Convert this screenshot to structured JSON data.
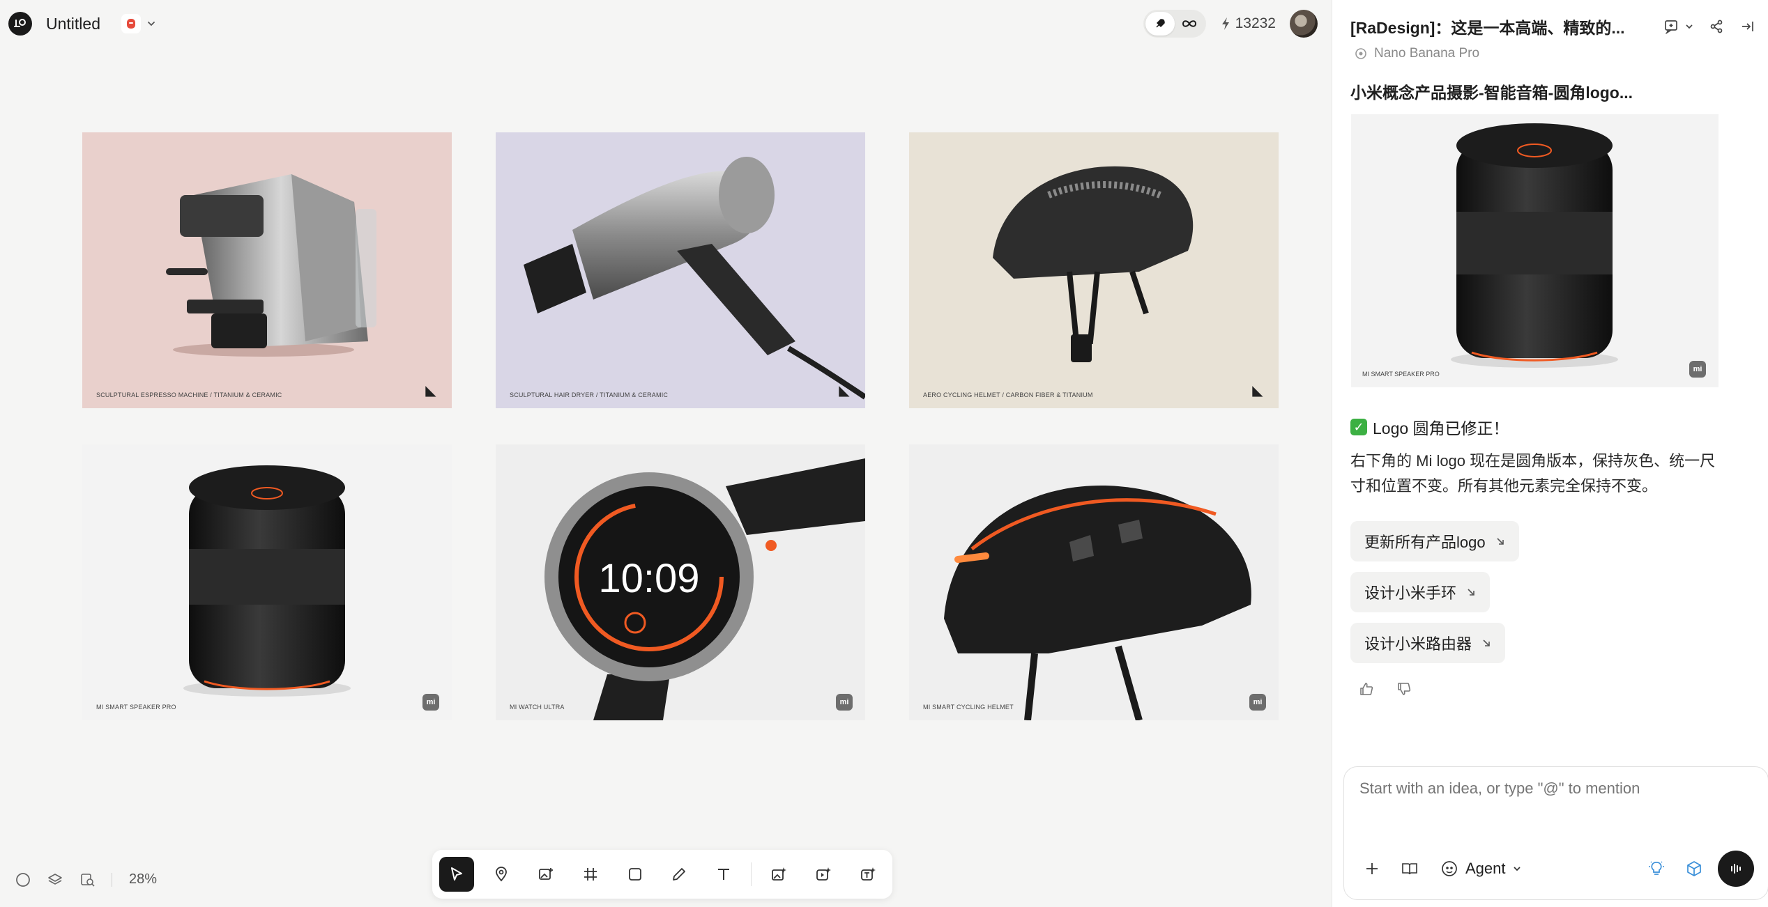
{
  "app": {
    "doc_title": "Untitled",
    "credits": "13232",
    "zoom": "28%"
  },
  "tiles": [
    {
      "caption": "SCULPTURAL ESPRESSO MACHINE / TITANIUM & CERAMIC",
      "mark": "r"
    },
    {
      "caption": "SCULPTURAL HAIR DRYER / TITANIUM & CERAMIC",
      "mark": "r"
    },
    {
      "caption": "AERO CYCLING HELMET / CARBON FIBER & TITANIUM",
      "mark": "r"
    },
    {
      "caption": "MI SMART SPEAKER PRO",
      "mark": "mi"
    },
    {
      "caption": "MI WATCH ULTRA",
      "mark": "mi",
      "watch_time": "10:09"
    },
    {
      "caption": "MI SMART CYCLING HELMET",
      "mark": "mi"
    }
  ],
  "panel": {
    "title": "[RaDesign]：这是一本高端、精致的...",
    "model": "Nano Banana Pro",
    "image_title": "小米概念产品摄影-智能音箱-圆角logo...",
    "preview_caption": "MI SMART SPEAKER PRO",
    "status": "Logo 圆角已修正！",
    "description": "右下角的 Mi logo 现在是圆角版本，保持灰色、统一尺寸和位置不变。所有其他元素完全保持不变。",
    "suggestions": [
      "更新所有产品logo",
      "设计小米手环",
      "设计小米路由器"
    ],
    "composer_placeholder": "Start with an idea, or type \"@\" to mention",
    "agent_label": "Agent"
  },
  "colors": {
    "accent_orange": "#f05a22",
    "success_green": "#3cb043",
    "dark": "#1a1a1a"
  }
}
